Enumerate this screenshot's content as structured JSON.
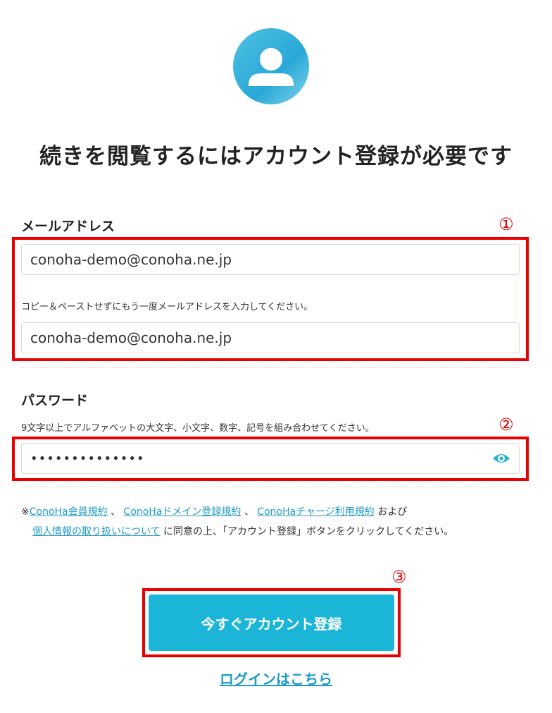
{
  "header": {
    "avatar_icon": "user-avatar-icon",
    "headline": "続きを閲覧するにはアカウント登録が必要です"
  },
  "email": {
    "label": "メールアドレス",
    "value": "conoha-demo@conoha.ne.jp",
    "confirm_hint": "コピー＆ペーストせずにもう一度メールアドレスを入力してください。",
    "confirm_value": "conoha-demo@conoha.ne.jp"
  },
  "password": {
    "label": "パスワード",
    "hint": "9文字以上でアルファベットの大文字、小文字、数字、記号を組み合わせてください。",
    "value": "••••••••••••••",
    "toggle_icon": "eye-icon"
  },
  "terms": {
    "prefix": "※",
    "link1": "ConoHa会員規約",
    "sep1": "、",
    "link2": "ConoHaドメイン登録規約",
    "sep2": "、",
    "link3": "ConoHaチャージ利用規約",
    "and": " および",
    "link4": "個人情報の取り扱いについて",
    "suffix": " に同意の上、「アカウント登録」ボタンをクリックしてください。"
  },
  "actions": {
    "register_button": "今すぐアカウント登録",
    "login_link": "ログインはこちら"
  },
  "annotations": {
    "marker1": "①",
    "marker2": "②",
    "marker3": "③"
  },
  "colors": {
    "accent": "#1bb5d8",
    "link": "#1e9bc4",
    "highlight": "#ea0000"
  }
}
